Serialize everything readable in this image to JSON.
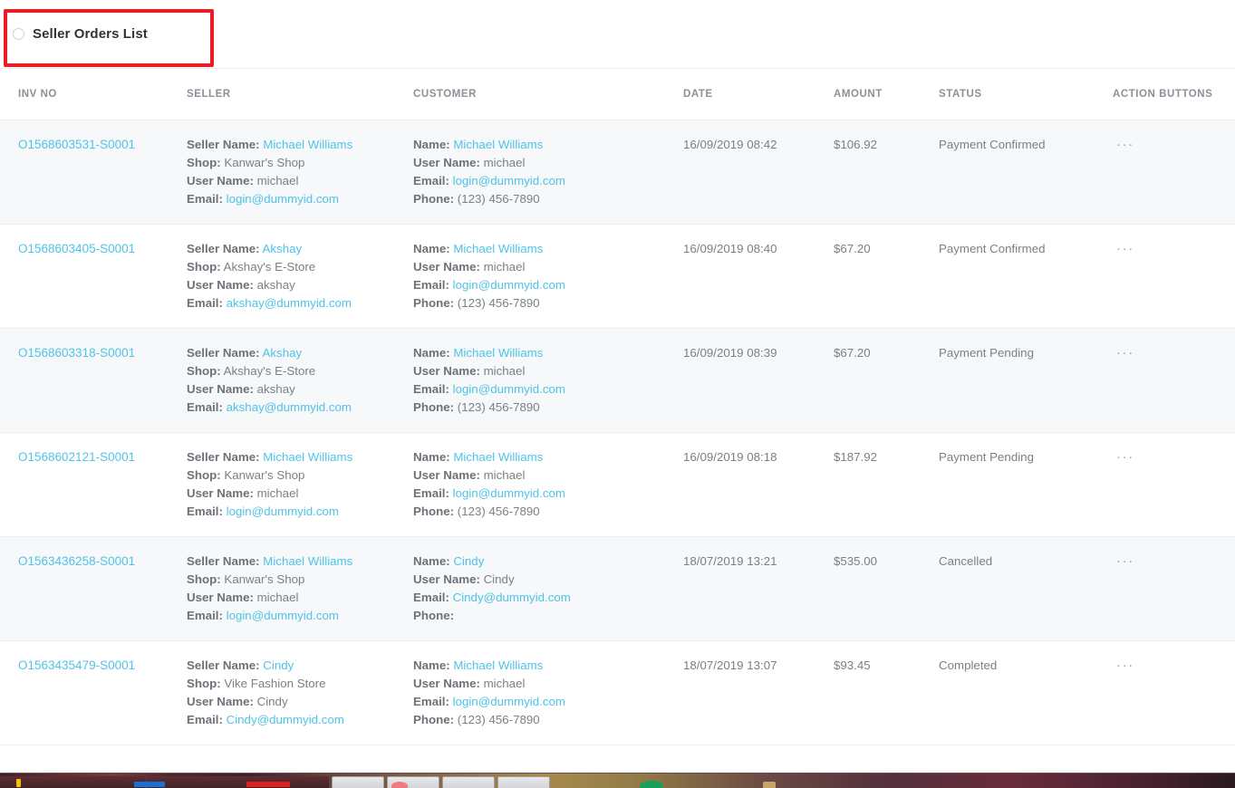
{
  "header": {
    "title": "Seller Orders List",
    "radio_icon": "radio-unchecked-icon",
    "highlight_color": "#ed1c24"
  },
  "theme": {
    "link_color": "#4fc3e8",
    "text_color": "#6c7278",
    "muted_color": "#8c9197",
    "row_alt_bg": "#f6f8f9",
    "row_bg": "#ffffff",
    "border_color": "#eceef1"
  },
  "table": {
    "columns": [
      {
        "key": "inv_no",
        "label": "INV NO"
      },
      {
        "key": "seller",
        "label": "SELLER"
      },
      {
        "key": "customer",
        "label": "CUSTOMER"
      },
      {
        "key": "date",
        "label": "DATE"
      },
      {
        "key": "amount",
        "label": "AMOUNT"
      },
      {
        "key": "status",
        "label": "STATUS"
      },
      {
        "key": "action",
        "label": "ACTION BUTTONS"
      }
    ],
    "labels": {
      "seller_name": "Seller Name:",
      "shop": "Shop:",
      "user_name": "User Name:",
      "email": "Email:",
      "name": "Name:",
      "phone": "Phone:"
    },
    "action_glyph": "···",
    "rows": [
      {
        "inv_no": "O1568603531-S0001",
        "seller": {
          "seller_name": "Michael Williams",
          "shop": "Kanwar's Shop",
          "user_name": "michael",
          "email": "login@dummyid.com"
        },
        "customer": {
          "name": "Michael Williams",
          "user_name": "michael",
          "email": "login@dummyid.com",
          "phone": "(123) 456-7890"
        },
        "date": "16/09/2019 08:42",
        "amount": "$106.92",
        "status": "Payment Confirmed"
      },
      {
        "inv_no": "O1568603405-S0001",
        "seller": {
          "seller_name": "Akshay",
          "shop": "Akshay's E-Store",
          "user_name": "akshay",
          "email": "akshay@dummyid.com"
        },
        "customer": {
          "name": "Michael Williams",
          "user_name": "michael",
          "email": "login@dummyid.com",
          "phone": "(123) 456-7890"
        },
        "date": "16/09/2019 08:40",
        "amount": "$67.20",
        "status": "Payment Confirmed"
      },
      {
        "inv_no": "O1568603318-S0001",
        "seller": {
          "seller_name": "Akshay",
          "shop": "Akshay's E-Store",
          "user_name": "akshay",
          "email": "akshay@dummyid.com"
        },
        "customer": {
          "name": "Michael Williams",
          "user_name": "michael",
          "email": "login@dummyid.com",
          "phone": "(123) 456-7890"
        },
        "date": "16/09/2019 08:39",
        "amount": "$67.20",
        "status": "Payment Pending"
      },
      {
        "inv_no": "O1568602121-S0001",
        "seller": {
          "seller_name": "Michael Williams",
          "shop": "Kanwar's Shop",
          "user_name": "michael",
          "email": "login@dummyid.com"
        },
        "customer": {
          "name": "Michael Williams",
          "user_name": "michael",
          "email": "login@dummyid.com",
          "phone": "(123) 456-7890"
        },
        "date": "16/09/2019 08:18",
        "amount": "$187.92",
        "status": "Payment Pending"
      },
      {
        "inv_no": "O1563436258-S0001",
        "seller": {
          "seller_name": "Michael Williams",
          "shop": "Kanwar's Shop",
          "user_name": "michael",
          "email": "login@dummyid.com"
        },
        "customer": {
          "name": "Cindy",
          "user_name": "Cindy",
          "email": "Cindy@dummyid.com",
          "phone": ""
        },
        "date": "18/07/2019 13:21",
        "amount": "$535.00",
        "status": "Cancelled"
      },
      {
        "inv_no": "O1563435479-S0001",
        "seller": {
          "seller_name": "Cindy",
          "shop": "Vike Fashion Store",
          "user_name": "Cindy",
          "email": "Cindy@dummyid.com"
        },
        "customer": {
          "name": "Michael Williams",
          "user_name": "michael",
          "email": "login@dummyid.com",
          "phone": "(123) 456-7890"
        },
        "date": "18/07/2019 13:07",
        "amount": "$93.45",
        "status": "Completed"
      }
    ]
  }
}
